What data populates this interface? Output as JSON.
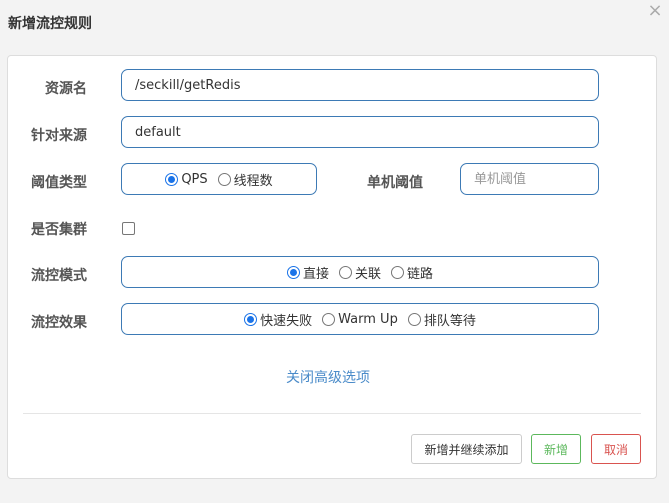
{
  "dialog": {
    "title": "新增流控规则",
    "close_icon": "×"
  },
  "form": {
    "resource_label": "资源名",
    "resource_value": "/seckill/getRedis",
    "source_label": "针对来源",
    "source_value": "default",
    "threshold_type_label": "阈值类型",
    "threshold_type_options": [
      "QPS",
      "线程数"
    ],
    "threshold_type_selected": "QPS",
    "single_threshold_label": "单机阈值",
    "single_threshold_placeholder": "单机阈值",
    "single_threshold_value": "",
    "cluster_label": "是否集群",
    "cluster_checked": false,
    "flow_mode_label": "流控模式",
    "flow_mode_options": [
      "直接",
      "关联",
      "链路"
    ],
    "flow_mode_selected": "直接",
    "flow_effect_label": "流控效果",
    "flow_effect_options": [
      "快速失败",
      "Warm Up",
      "排队等待"
    ],
    "flow_effect_selected": "快速失败",
    "advanced_toggle": "关闭高级选项"
  },
  "footer": {
    "add_continue": "新增并继续添加",
    "add": "新增",
    "cancel": "取消"
  },
  "colors": {
    "accent": "#3d7ab5",
    "radio_checked": "#1a73e8",
    "link": "#4a8bc9",
    "success": "#5cb85c",
    "danger": "#d9534f"
  }
}
